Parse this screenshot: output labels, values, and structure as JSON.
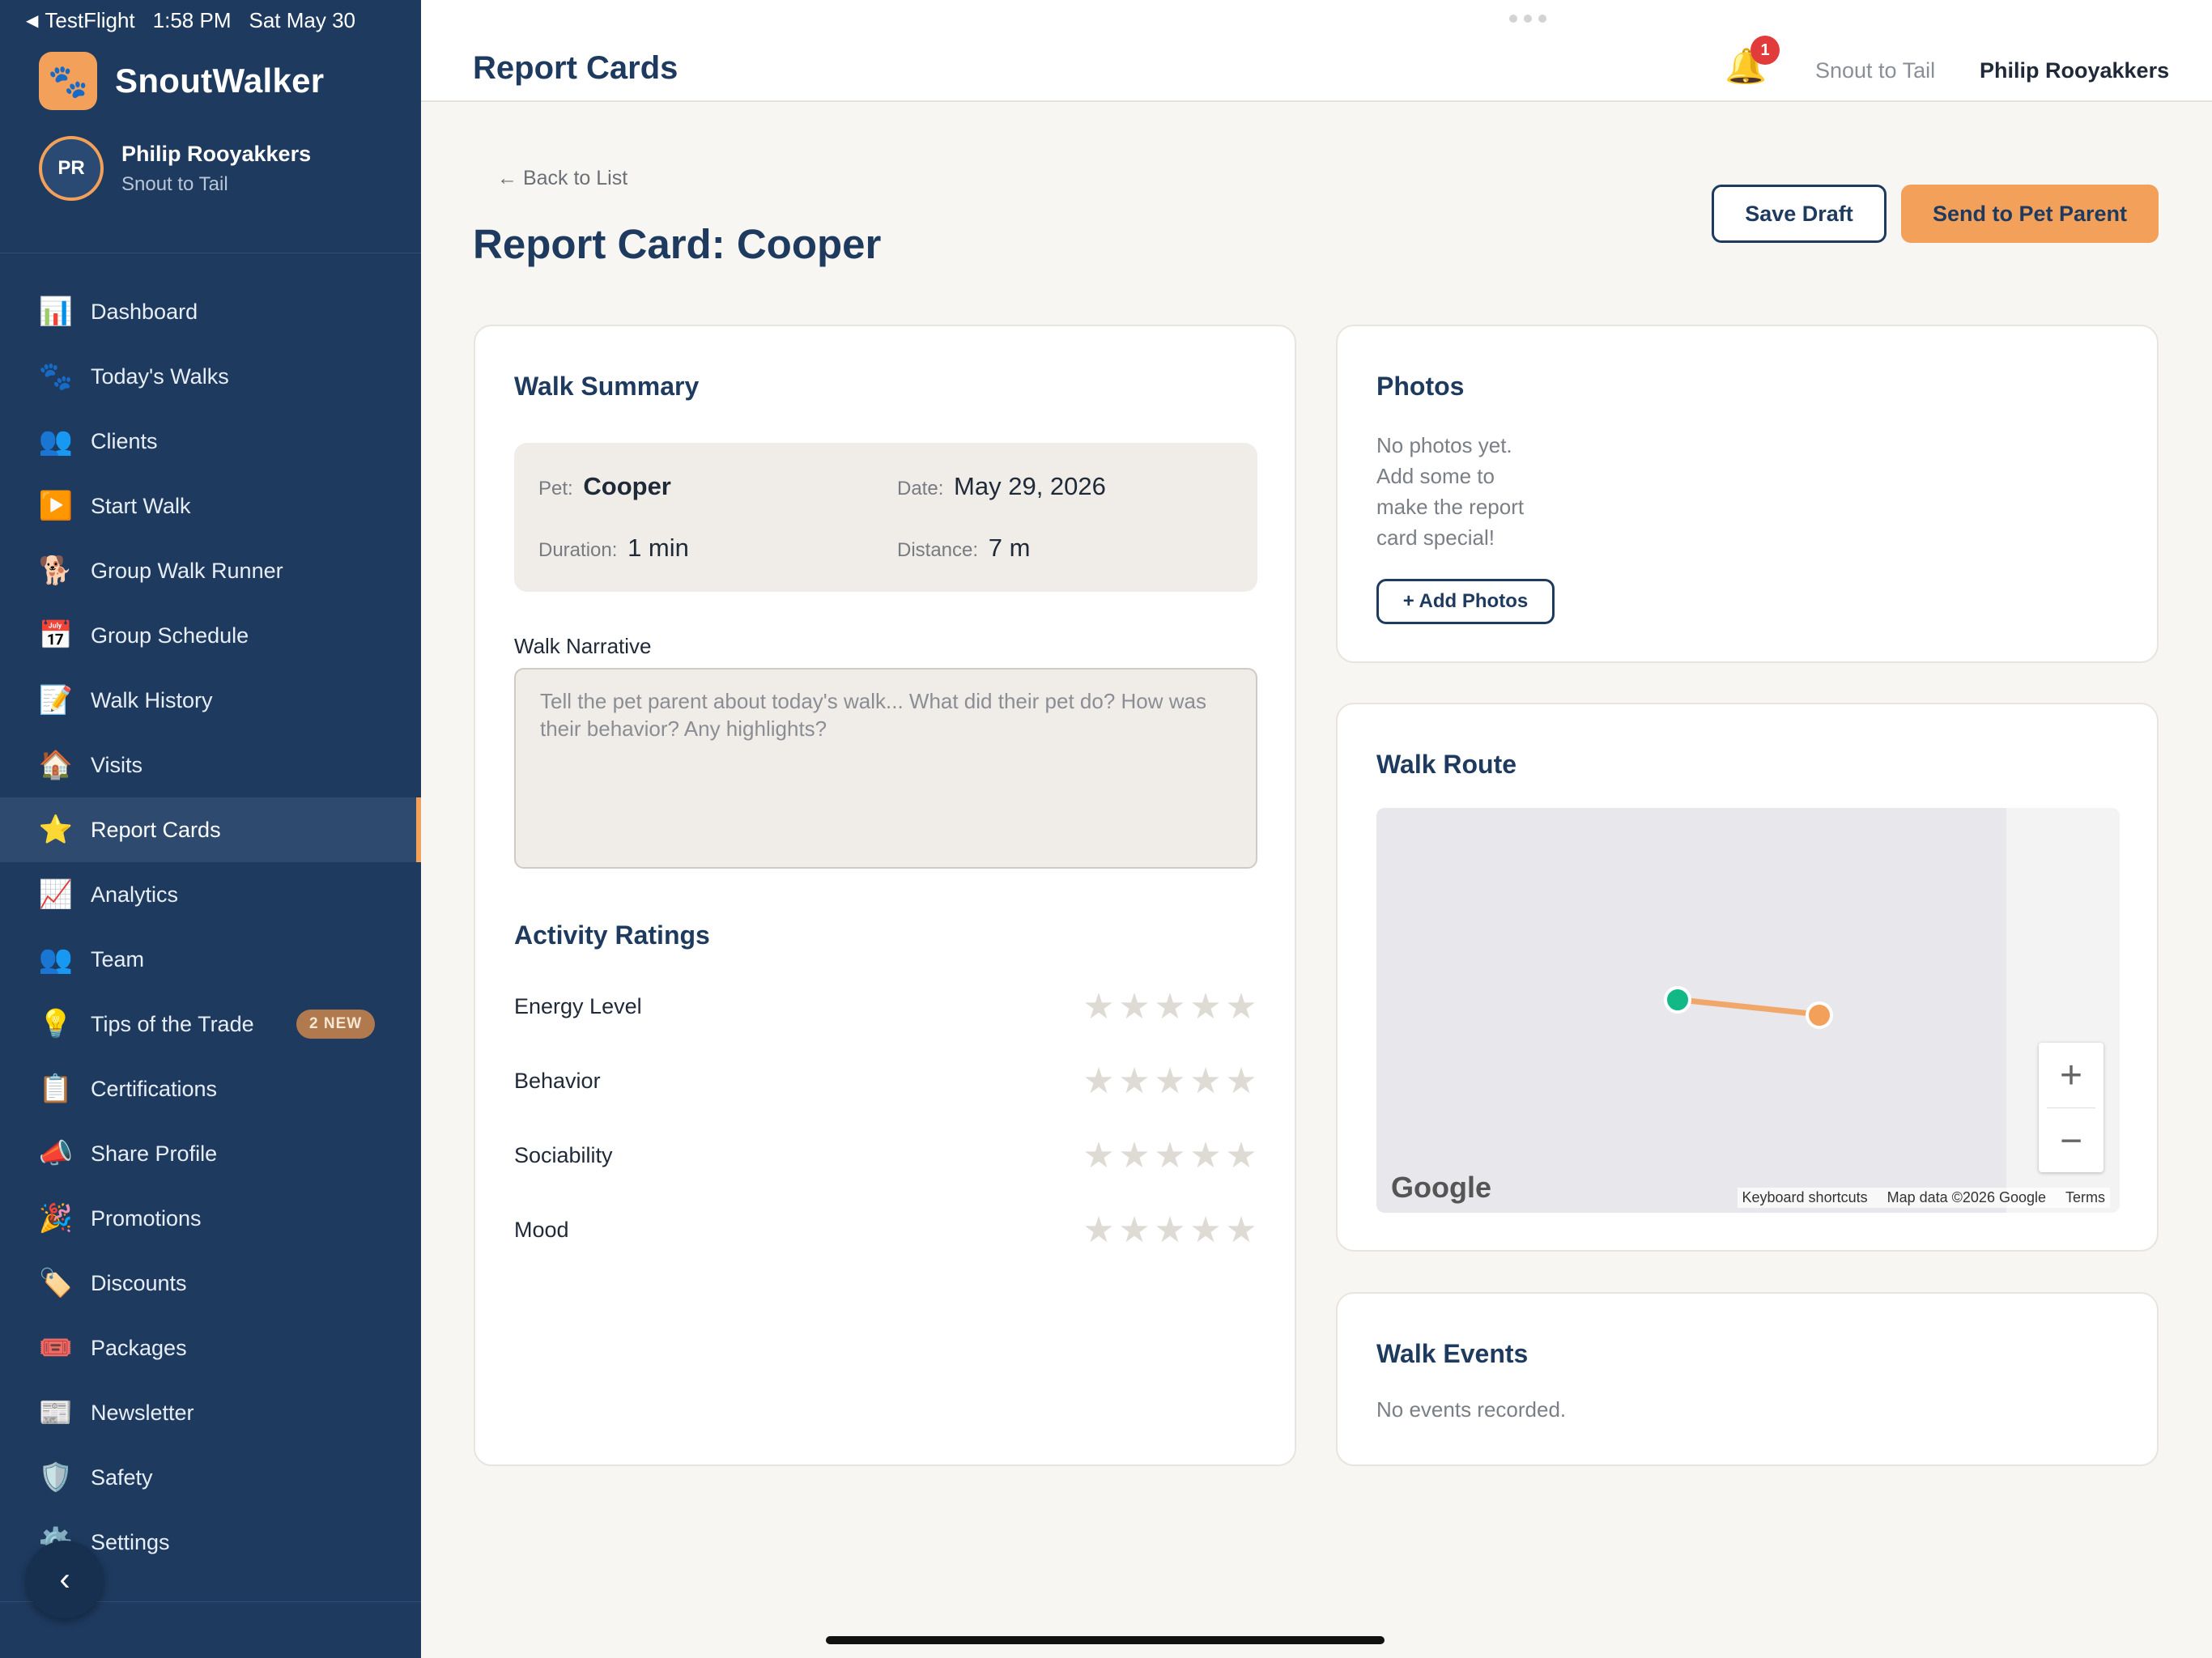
{
  "status_bar": {
    "app": "TestFlight",
    "time": "1:58 PM",
    "date": "Sat May 30"
  },
  "brand": {
    "name": "SnoutWalker",
    "logo_icon": "paw-icon"
  },
  "user": {
    "initials": "PR",
    "name": "Philip Rooyakkers",
    "org": "Snout to Tail"
  },
  "sidebar": {
    "items": [
      {
        "label": "Dashboard",
        "icon": "📊"
      },
      {
        "label": "Today's Walks",
        "icon": "🐾"
      },
      {
        "label": "Clients",
        "icon": "👥"
      },
      {
        "label": "Start Walk",
        "icon": "▶️"
      },
      {
        "label": "Group Walk Runner",
        "icon": "🐕"
      },
      {
        "label": "Group Schedule",
        "icon": "📅"
      },
      {
        "label": "Walk History",
        "icon": "📝"
      },
      {
        "label": "Visits",
        "icon": "🏠"
      },
      {
        "label": "Report Cards",
        "icon": "⭐",
        "active": true
      },
      {
        "label": "Analytics",
        "icon": "📈"
      },
      {
        "label": "Team",
        "icon": "👥"
      },
      {
        "label": "Tips of the Trade",
        "icon": "💡",
        "badge": "2 NEW"
      },
      {
        "label": "Certifications",
        "icon": "📋"
      },
      {
        "label": "Share Profile",
        "icon": "📣"
      },
      {
        "label": "Promotions",
        "icon": "🎉"
      },
      {
        "label": "Discounts",
        "icon": "🏷️"
      },
      {
        "label": "Packages",
        "icon": "🎟️"
      },
      {
        "label": "Newsletter",
        "icon": "📰"
      },
      {
        "label": "Safety",
        "icon": "🛡️"
      },
      {
        "label": "Settings",
        "icon": "⚙️"
      }
    ],
    "collapse_icon": "‹"
  },
  "header": {
    "title": "Report Cards",
    "notifications": "1",
    "org": "Snout to Tail",
    "user": "Philip Rooyakkers"
  },
  "page": {
    "back_link": "← Back to List",
    "title": "Report Card: Cooper",
    "save_draft": "Save Draft",
    "send": "Send to Pet Parent"
  },
  "summary": {
    "title": "Walk Summary",
    "pet_label": "Pet:",
    "pet": "Cooper",
    "date_label": "Date:",
    "date": "May 29, 2026",
    "duration_label": "Duration:",
    "duration": "1 min",
    "distance_label": "Distance:",
    "distance": "7 m",
    "narrative_label": "Walk Narrative",
    "narrative_placeholder": "Tell the pet parent about today's walk... What did their pet do? How was their behavior? Any highlights?"
  },
  "ratings": {
    "title": "Activity Ratings",
    "items": [
      {
        "label": "Energy Level",
        "value": 0,
        "max": 5
      },
      {
        "label": "Behavior",
        "value": 0,
        "max": 5
      },
      {
        "label": "Sociability",
        "value": 0,
        "max": 5
      },
      {
        "label": "Mood",
        "value": 0,
        "max": 5
      }
    ]
  },
  "photos": {
    "title": "Photos",
    "empty": "No photos yet. Add some to make the report card special!",
    "add_button": "+ Add Photos"
  },
  "route": {
    "title": "Walk Route",
    "map_logo": "Google",
    "attribution": [
      "Keyboard shortcuts",
      "Map data ©2026 Google",
      "Terms"
    ],
    "zoom_in": "+",
    "zoom_out": "−",
    "start_color": "#12b886",
    "end_color": "#f2a05a"
  },
  "events": {
    "title": "Walk Events",
    "empty": "No events recorded."
  },
  "colors": {
    "sidebar": "#1e3a5f",
    "accent": "#f2a05a",
    "navy": "#1e3a5f"
  }
}
